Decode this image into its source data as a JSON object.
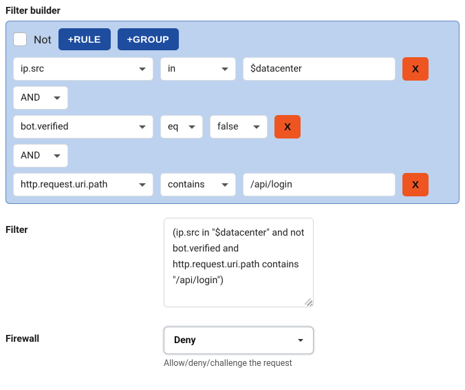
{
  "title": "Filter builder",
  "builder": {
    "not_label": "Not",
    "add_rule_label": "+RULE",
    "add_group_label": "+GROUP",
    "delete_label": "X",
    "logic": "AND",
    "rules": [
      {
        "field": "ip.src",
        "op": "in",
        "value": "$datacenter"
      },
      {
        "field": "bot.verified",
        "op": "eq",
        "value": "false"
      },
      {
        "field": "http.request.uri.path",
        "op": "contains",
        "value": "/api/login"
      }
    ]
  },
  "filter": {
    "label": "Filter",
    "expression": "(ip.src in \"$datacenter\" and not bot.verified and http.request.uri.path contains \"/api/login\")"
  },
  "firewall": {
    "label": "Firewall",
    "selected": "Deny",
    "hint": "Allow/deny/challenge the request"
  }
}
